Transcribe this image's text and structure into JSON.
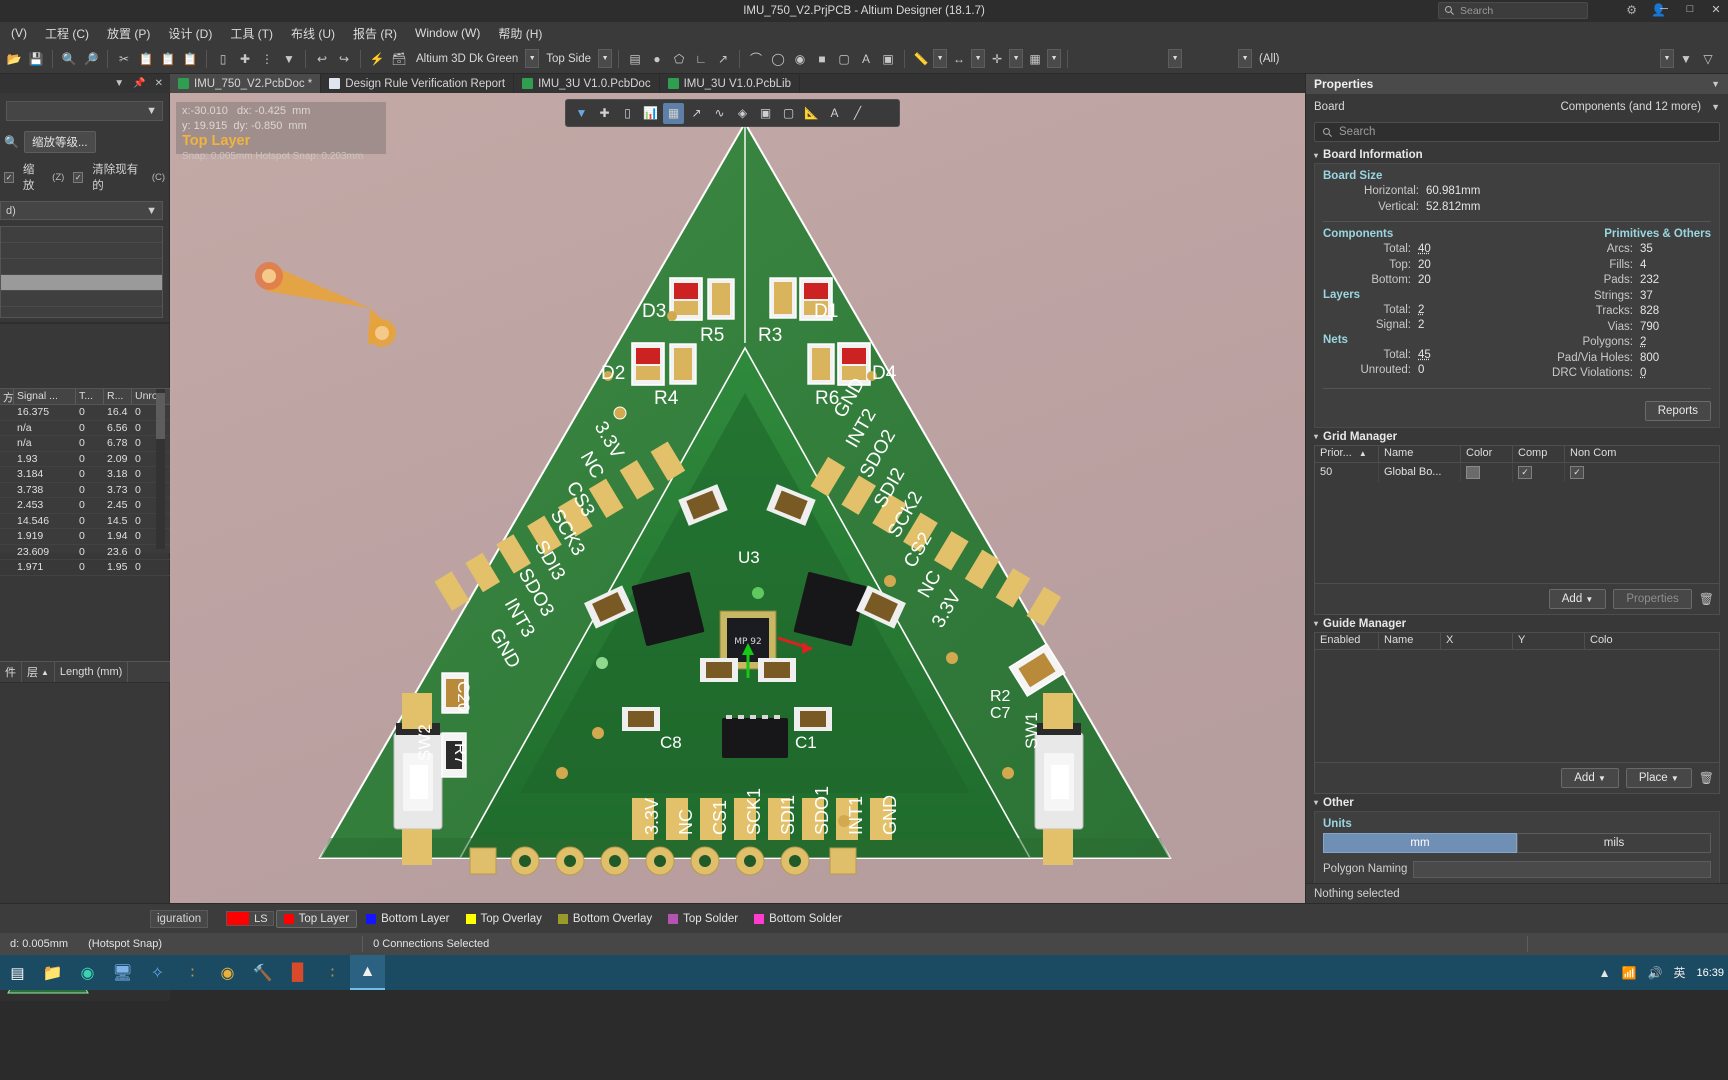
{
  "window": {
    "title": "IMU_750_V2.PrjPCB - Altium Designer (18.1.7)",
    "search_placeholder": "Search",
    "minimize": "─",
    "maximize": "□",
    "close": "✕"
  },
  "menu": [
    "(V)",
    "工程 (C)",
    "放置 (P)",
    "设计 (D)",
    "工具 (T)",
    "布线 (U)",
    "报告 (R)",
    "Window (W)",
    "帮助 (H)"
  ],
  "toolbar": {
    "view_config": "Altium 3D Dk Green",
    "side": "Top Side",
    "all_label": "(All)"
  },
  "doc_tabs": [
    {
      "label": "IMU_750_V2.PcbDoc *",
      "icon": "pcb-icon",
      "active": true
    },
    {
      "label": "Design Rule Verification Report",
      "icon": "report-icon",
      "active": false
    },
    {
      "label": "IMU_3U V1.0.PcbDoc",
      "icon": "pcb-icon",
      "active": false
    },
    {
      "label": "IMU_3U V1.0.PcbLib",
      "icon": "pcblib-icon",
      "active": false
    }
  ],
  "left_panel": {
    "zoom_level_button": "缩放等级...",
    "checkbox_zoom": "缩放",
    "checkbox_zoom_key": "(Z)",
    "checkbox_clear": "清除现有的",
    "checkbox_clear_key": "(C)",
    "mask_combo": "d)",
    "table_headers": [
      "方.",
      "Signal ...",
      "T...",
      "R...",
      "Unrout..."
    ],
    "table_rows": [
      {
        "signal": "16.375",
        "t": "0",
        "r": "16.4",
        "unrouted": "0"
      },
      {
        "signal": "n/a",
        "t": "0",
        "r": "6.56",
        "unrouted": "0"
      },
      {
        "signal": "n/a",
        "t": "0",
        "r": "6.78",
        "unrouted": "0"
      },
      {
        "signal": "1.93",
        "t": "0",
        "r": "2.09",
        "unrouted": "0"
      },
      {
        "signal": "3.184",
        "t": "0",
        "r": "3.18",
        "unrouted": "0"
      },
      {
        "signal": "3.738",
        "t": "0",
        "r": "3.73",
        "unrouted": "0"
      },
      {
        "signal": "2.453",
        "t": "0",
        "r": "2.45",
        "unrouted": "0"
      },
      {
        "signal": "14.546",
        "t": "0",
        "r": "14.5",
        "unrouted": "0"
      },
      {
        "signal": "1.919",
        "t": "0",
        "r": "1.94",
        "unrouted": "0"
      },
      {
        "signal": "23.609",
        "t": "0",
        "r": "23.6",
        "unrouted": "0"
      },
      {
        "signal": "1.971",
        "t": "0",
        "r": "1.95",
        "unrouted": "0"
      }
    ],
    "bottom_cols": [
      "件",
      "层",
      "Length (mm)"
    ],
    "config_button": "iguration"
  },
  "canvas": {
    "cursor_x": "x:-30.010",
    "cursor_dx": "dx: -0.425  mm",
    "cursor_y": "y: 19.915",
    "cursor_dy": "dy: -0.850  mm",
    "active_layer": "Top Layer",
    "snap": "Snap: 0.005mm Hotspot Snap: 0.203mm"
  },
  "float_toolbar": [
    "filter-icon",
    "crosshair-icon",
    "select-rect-icon",
    "chart-icon",
    "grid-icon",
    "route-icon",
    "via-icon",
    "polygon-icon",
    "component-icon",
    "dimension-icon",
    "text-icon",
    "line-icon"
  ],
  "board_silkscreen": {
    "designators": [
      "D3",
      "R5",
      "D1",
      "R3",
      "D2",
      "R4",
      "D4",
      "R6",
      "C8",
      "C1",
      "C20",
      "R7",
      "SW2",
      "SW1",
      "R2",
      "C7",
      "U3"
    ],
    "left_pins": [
      "3.3V",
      "NC",
      "CS3",
      "SCK3",
      "SDI3",
      "SDO3",
      "INT3",
      "GND"
    ],
    "right_pins": [
      "GND",
      "INT2",
      "SDO2",
      "SDI2",
      "SCK2",
      "CS2",
      "NC",
      "3.3V"
    ],
    "bottom_pins": [
      "3.3V",
      "NC",
      "CS1",
      "SCK1",
      "SDI1",
      "SDO1",
      "INT1",
      "GND"
    ],
    "chip_marking": "MP 92"
  },
  "layer_bar": {
    "ls_label": "LS",
    "ls_color": "#ff0000",
    "layers": [
      {
        "name": "Top Layer",
        "color": "#ff0000",
        "selected": true
      },
      {
        "name": "Bottom Layer",
        "color": "#1414ff",
        "selected": false
      },
      {
        "name": "Top Overlay",
        "color": "#ffff00",
        "selected": false
      },
      {
        "name": "Bottom Overlay",
        "color": "#9a9a2a",
        "selected": false
      },
      {
        "name": "Top Solder",
        "color": "#b354b3",
        "selected": false
      },
      {
        "name": "Bottom Solder",
        "color": "#ff3ccf",
        "selected": false
      }
    ]
  },
  "status_bar": {
    "grid": "d: 0.005mm",
    "snap_mode": "(Hotspot Snap)",
    "connections": "0 Connections Selected"
  },
  "taskbar": {
    "icons": [
      "start-icon",
      "files-icon",
      "app-green-icon",
      "dev-icon",
      "blue-star-icon",
      "gold-s-icon",
      "chrome-icon",
      "tool-icon",
      "adobe-icon",
      "gold-s2-icon",
      "altium-icon"
    ],
    "tray": [
      "chevron-up-icon",
      "network-icon",
      "volume-icon",
      "ime-icon"
    ],
    "ime": "英",
    "clock": "16:39"
  },
  "properties": {
    "panel_title": "Properties",
    "board_label": "Board",
    "board_value": "Components (and 12 more)",
    "search_placeholder": "Search",
    "sections": {
      "board_information": {
        "title": "Board Information",
        "board_size_title": "Board Size",
        "board_size": [
          {
            "k": "Horizontal:",
            "v": "60.981mm"
          },
          {
            "k": "Vertical:",
            "v": "52.812mm"
          }
        ],
        "components_title": "Components",
        "components": [
          {
            "k": "Total:",
            "v": "40",
            "link": true
          },
          {
            "k": "Top:",
            "v": "20",
            "link": false
          },
          {
            "k": "Bottom:",
            "v": "20",
            "link": false
          }
        ],
        "layers_title": "Layers",
        "layers": [
          {
            "k": "Total:",
            "v": "2",
            "link": true
          },
          {
            "k": "Signal:",
            "v": "2",
            "link": false
          }
        ],
        "nets_title": "Nets",
        "nets": [
          {
            "k": "Total:",
            "v": "45",
            "link": true
          },
          {
            "k": "Unrouted:",
            "v": "0",
            "link": false
          }
        ],
        "primitives_title": "Primitives & Others",
        "primitives": [
          {
            "k": "Arcs:",
            "v": "35",
            "link": false
          },
          {
            "k": "Fills:",
            "v": "4",
            "link": false
          },
          {
            "k": "Pads:",
            "v": "232",
            "link": false
          },
          {
            "k": "Strings:",
            "v": "37",
            "link": false
          },
          {
            "k": "Tracks:",
            "v": "828",
            "link": false
          },
          {
            "k": "Vias:",
            "v": "790",
            "link": false
          },
          {
            "k": "Polygons:",
            "v": "2",
            "link": true
          },
          {
            "k": "Pad/Via Holes:",
            "v": "800",
            "link": false
          },
          {
            "k": "DRC Violations:",
            "v": "0",
            "link": true
          }
        ],
        "reports_button": "Reports"
      },
      "grid_manager": {
        "title": "Grid Manager",
        "headers": [
          "Prior...",
          "Name",
          "Color",
          "Comp",
          "Non Com"
        ],
        "rows": [
          {
            "priority": "50",
            "name": "Global Bo...",
            "color": "#6b6b6b",
            "comp": true,
            "noncomp": true
          }
        ],
        "add_button": "Add",
        "properties_button": "Properties",
        "delete_icon": "trash-icon"
      },
      "guide_manager": {
        "title": "Guide Manager",
        "headers": [
          "Enabled",
          "Name",
          "X",
          "Y",
          "Colo"
        ],
        "rows": [],
        "add_button": "Add",
        "place_button": "Place",
        "delete_icon": "trash-icon"
      },
      "other": {
        "title": "Other",
        "units_label": "Units",
        "units": [
          {
            "label": "mm",
            "selected": true
          },
          {
            "label": "mils",
            "selected": false
          }
        ],
        "polygon_naming_label": "Polygon Naming"
      }
    },
    "footer": "Nothing selected"
  }
}
